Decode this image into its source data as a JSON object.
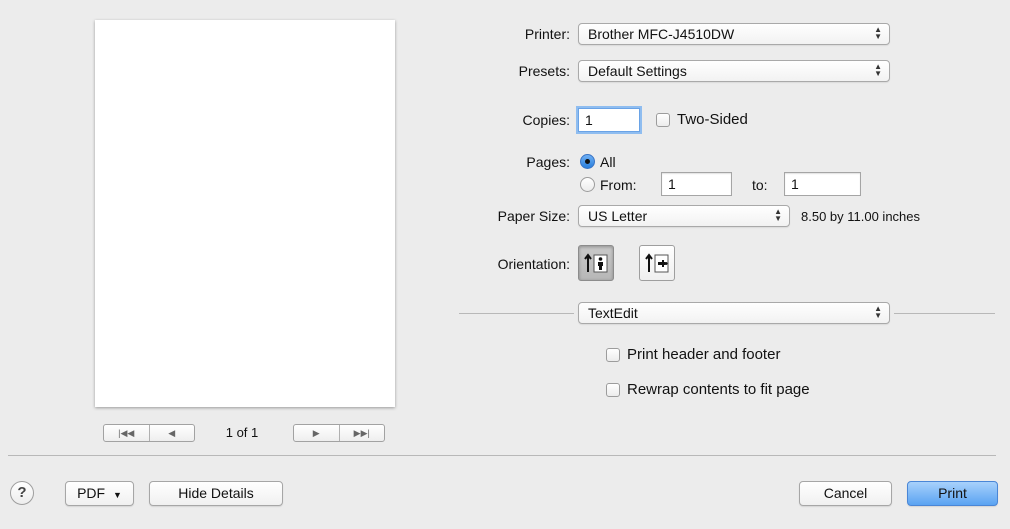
{
  "printer": {
    "label": "Printer:",
    "value": "Brother MFC-J4510DW"
  },
  "presets": {
    "label": "Presets:",
    "value": "Default Settings"
  },
  "copies": {
    "label": "Copies:",
    "value": "1",
    "two_sided_label": "Two-Sided"
  },
  "pages": {
    "label": "Pages:",
    "all_label": "All",
    "from_label": "From:",
    "from_value": "1",
    "to_label": "to:",
    "to_value": "1"
  },
  "paper_size": {
    "label": "Paper Size:",
    "value": "US Letter",
    "dimensions": "8.50 by 11.00 inches"
  },
  "orientation": {
    "label": "Orientation:"
  },
  "app_section": {
    "value": "TextEdit"
  },
  "options": {
    "header_footer_label": "Print header and footer",
    "rewrap_label": "Rewrap contents to fit page"
  },
  "preview": {
    "page_indicator": "1 of 1"
  },
  "footer": {
    "help_label": "?",
    "pdf_label": "PDF",
    "hide_details_label": "Hide Details",
    "cancel_label": "Cancel",
    "print_label": "Print"
  },
  "colors": {
    "accent": "#5aa3f2",
    "background": "#ececec"
  }
}
